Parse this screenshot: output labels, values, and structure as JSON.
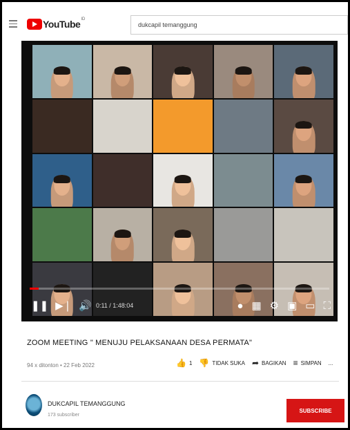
{
  "header": {
    "logo_text": "YouTube",
    "logo_sup": "ID",
    "search_value": "dukcapil temanggung"
  },
  "video": {
    "time": "0:11 / 1:48:04",
    "progress_fraction": 0.03,
    "participant_tiles": 25
  },
  "info": {
    "title": "ZOOM MEETING \" MENUJU PELAKSANAAN DESA PERMATA\"",
    "meta": "94 x ditonton • 22 Feb 2022",
    "likes": "1",
    "dislike_label": "TIDAK SUKA",
    "share_label": "BAGIKAN",
    "save_label": "SIMPAN",
    "more_label": "..."
  },
  "channel": {
    "name": "DUKCAPIL TEMANGGUNG",
    "subs": "173 subscriber",
    "subscribe_label": "SUBSCRIBE"
  },
  "colors": {
    "brand_red": "#ee0000",
    "subscribe": "#d61515",
    "progress": "#ff0000"
  }
}
